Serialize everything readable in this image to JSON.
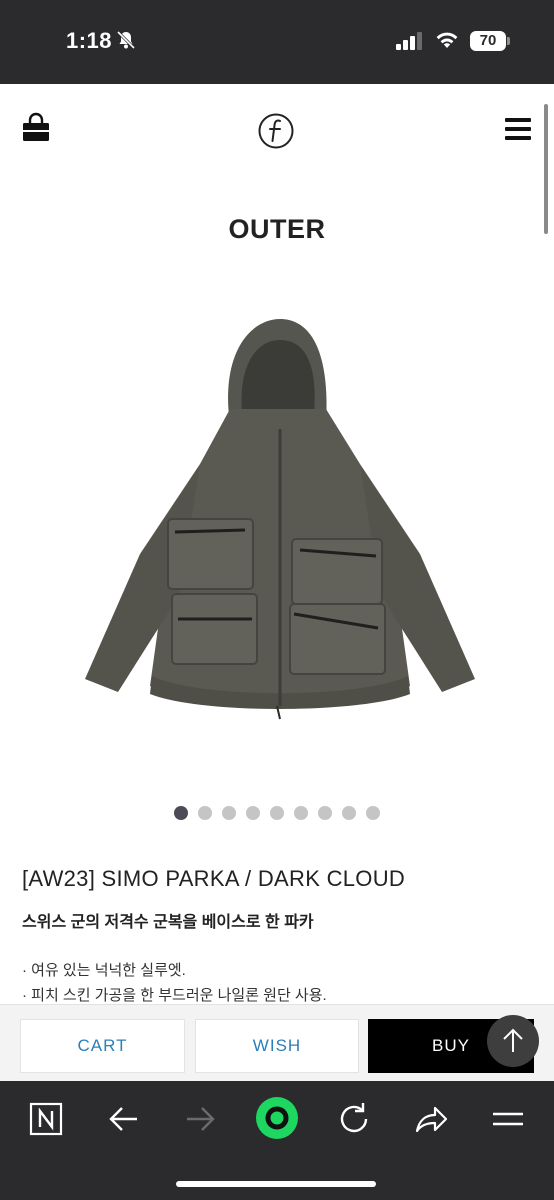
{
  "status": {
    "time": "1:18",
    "battery": "70"
  },
  "page": {
    "title": "OUTER"
  },
  "gallery": {
    "total_images": 9,
    "active_index": 0
  },
  "product": {
    "name": "[AW23] SIMO PARKA / DARK CLOUD",
    "tagline": "스위스 군의 저격수 군복을 베이스로 한 파카",
    "features": [
      "· 여유 있는 넉넉한 실루엣.",
      "· 피치 스킨 가공을 한 부드러운 나일론 원단 사용."
    ]
  },
  "actions": {
    "cart": "CART",
    "wish": "WISH",
    "buy": "BUY"
  },
  "colors": {
    "link_blue": "#2c7fb8",
    "jacket": "#5b5a52",
    "accent_green": "#1ed760"
  },
  "icons": [
    "mute-icon",
    "signal-icon",
    "wifi-icon",
    "shopping-bag-icon",
    "brand-logo-icon",
    "hamburger-menu-icon",
    "arrow-up-icon",
    "n-icon",
    "back-arrow-icon",
    "forward-arrow-icon",
    "green-circle-icon",
    "reload-icon",
    "share-icon",
    "menu-lines-icon"
  ]
}
